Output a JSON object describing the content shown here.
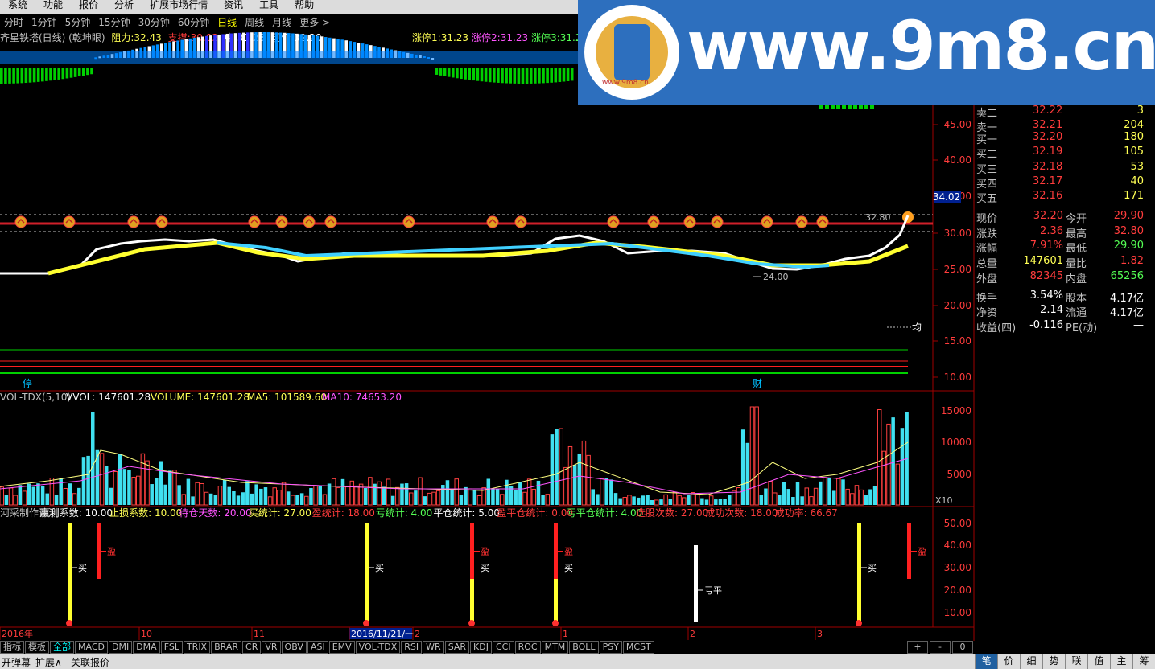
{
  "menu": [
    "系统",
    "功能",
    "报价",
    "分析",
    "扩展市场行情",
    "资讯",
    "工具",
    "帮助"
  ],
  "periods": {
    "items": [
      "分时",
      "1分钟",
      "5分钟",
      "15分钟",
      "30分钟",
      "60分钟",
      "日线",
      "周线",
      "月线",
      "更多 >"
    ],
    "active": "日线"
  },
  "info": {
    "title": "齐星铁塔(日线) (乾坤眼)",
    "resist_label": "阻力:",
    "resist": "32.43",
    "support_label": "支撑:",
    "support": "30.02",
    "mid_label": "中:",
    "mid": "31.23",
    "price_label": "现价:",
    "price": "32.20"
  },
  "stops": [
    {
      "label": "涨停1:",
      "value": "31.23"
    },
    {
      "label": "涨停2:",
      "value": "31.23"
    },
    {
      "label": "涨停3:",
      "value": "31.2"
    }
  ],
  "watermark": {
    "text": "www.9m8.cn",
    "small": "www.9m8.cn"
  },
  "price_axis": [
    "45.00",
    "40.00",
    "35.00",
    "30.00",
    "25.00",
    "20.00",
    "15.00",
    "10.00"
  ],
  "price_axis_highlight": "34.02",
  "annotations": {
    "high": "32.80",
    "low": "24.00",
    "avg": "均",
    "mark1": "停",
    "mark2": "财"
  },
  "quote": {
    "sells": [
      {
        "label": "卖二",
        "price": "32.22",
        "vol": "3"
      },
      {
        "label": "卖一",
        "price": "32.21",
        "vol": "204"
      }
    ],
    "buys": [
      {
        "label": "买一",
        "price": "32.20",
        "vol": "180"
      },
      {
        "label": "买二",
        "price": "32.19",
        "vol": "105"
      },
      {
        "label": "买三",
        "price": "32.18",
        "vol": "53"
      },
      {
        "label": "买四",
        "price": "32.17",
        "vol": "40"
      },
      {
        "label": "买五",
        "price": "32.16",
        "vol": "171"
      }
    ],
    "stats": [
      {
        "l1": "现价",
        "v1": "32.20",
        "l2": "今开",
        "v2": "29.90"
      },
      {
        "l1": "涨跌",
        "v1": "2.36",
        "l2": "最高",
        "v2": "32.80"
      },
      {
        "l1": "涨幅",
        "v1": "7.91%",
        "l2": "最低",
        "v2": "29.90"
      },
      {
        "l1": "总量",
        "v1": "147601",
        "l2": "量比",
        "v2": "1.82"
      },
      {
        "l1": "外盘",
        "v1": "82345",
        "l2": "内盘",
        "v2": "65256"
      },
      {
        "l1": "换手",
        "v1": "3.54%",
        "l2": "股本",
        "v2": "4.17亿"
      },
      {
        "l1": "净资",
        "v1": "2.14",
        "l2": "流通",
        "v2": "4.17亿"
      },
      {
        "l1": "收益(四)",
        "v1": "-0.116",
        "l2": "PE(动)",
        "v2": "—"
      }
    ]
  },
  "vol_header": {
    "name": "VOL-TDX(5,10)",
    "vvol": "VVOL: 147601.28",
    "volume": "VOLUME: 147601.28",
    "ma5": "MA5: 101589.60",
    "ma10": "MA10: 74653.20"
  },
  "vol_axis": [
    "15000",
    "10000",
    "5000"
  ],
  "vol_unit": "X10",
  "eval_header": [
    {
      "t": "河采制作评测",
      "c": "#c0c0c0"
    },
    {
      "t": "赢利系数: 10.00",
      "c": "#ffffff"
    },
    {
      "t": "止损系数: 10.00",
      "c": "#ffff54"
    },
    {
      "t": "待仓天数: 20.00",
      "c": "#ff54ff"
    },
    {
      "t": "买统计: 27.00",
      "c": "#ffff54"
    },
    {
      "t": "盈统计: 18.00",
      "c": "#ff3c3c"
    },
    {
      "t": "亏统计: 4.00",
      "c": "#54ff54"
    },
    {
      "t": "平仓统计: 5.00",
      "c": "#ffffff"
    },
    {
      "t": "盈平仓统计: 0.00",
      "c": "#ff3c3c"
    },
    {
      "t": "亏平仓统计: 4.00",
      "c": "#54ff54"
    },
    {
      "t": "选股次数: 27.00",
      "c": "#ff3c3c"
    },
    {
      "t": "成功次数: 18.00",
      "c": "#ff3c3c"
    },
    {
      "t": "成功率: 66.67",
      "c": "#ff3c3c"
    }
  ],
  "eval_axis": [
    "50.00",
    "40.00",
    "30.00",
    "20.00",
    "10.00"
  ],
  "signals": {
    "buy": "买",
    "profit": "盈",
    "lossflat": "亏平"
  },
  "time_axis": [
    {
      "t": "2016年",
      "c": "#ff3c3c"
    },
    {
      "t": "10",
      "c": "#ff3c3c"
    },
    {
      "t": "11",
      "c": "#ff3c3c"
    },
    {
      "t": "2016/11/21/一",
      "c": "#ffffff"
    },
    {
      "t": "2",
      "c": "#ff3c3c"
    },
    {
      "t": "1",
      "c": "#ff3c3c"
    },
    {
      "t": "2",
      "c": "#ff3c3c"
    },
    {
      "t": "3",
      "c": "#ff3c3c"
    }
  ],
  "tabs": [
    "指标",
    "模板",
    "全部",
    "MACD",
    "DMI",
    "DMA",
    "FSL",
    "TRIX",
    "BRAR",
    "CR",
    "VR",
    "OBV",
    "ASI",
    "EMV",
    "VOL-TDX",
    "RSI",
    "WR",
    "SAR",
    "KDJ",
    "CCI",
    "ROC",
    "MTM",
    "BOLL",
    "PSY",
    "MCST"
  ],
  "tabs_active": "全部",
  "tab_controls": [
    "+",
    "-",
    "0"
  ],
  "bottom": [
    "开弹幕",
    "扩展∧",
    "关联报价"
  ],
  "right_tabs": [
    "笔",
    "价",
    "细",
    "势",
    "联",
    "值",
    "主",
    "筹"
  ],
  "right_tabs_active": "笔"
}
